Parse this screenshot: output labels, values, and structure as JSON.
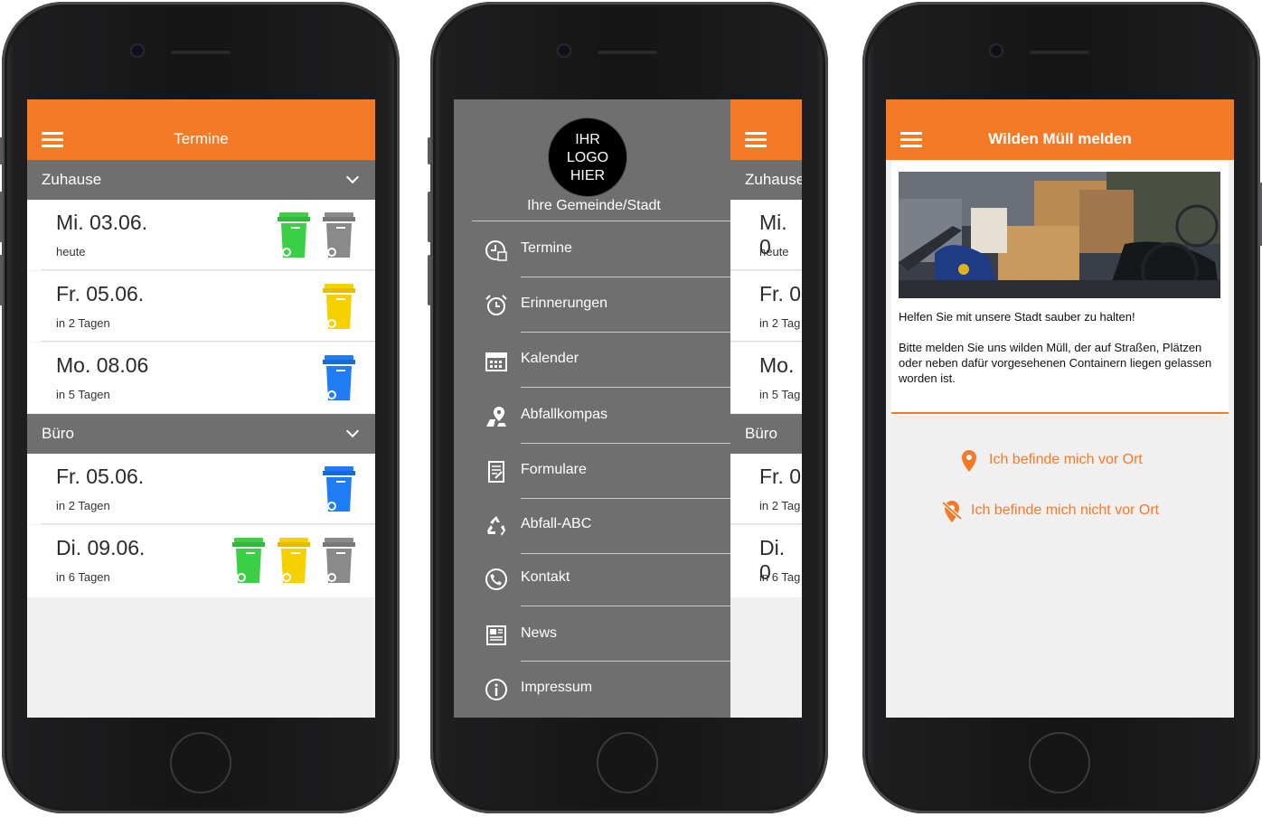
{
  "colors": {
    "accent": "#f47a27",
    "group_bg": "#6f6f6f",
    "bin_green": "#3bd046",
    "bin_gray": "#8a8a8a",
    "bin_yellow": "#f7d000",
    "bin_blue": "#1f7cf2"
  },
  "screen1": {
    "title": "Termine",
    "groups": [
      {
        "name": "Zuhause",
        "entries": [
          {
            "date": "Mi. 03.06.",
            "sub": "heute",
            "bins": [
              "green",
              "gray"
            ]
          },
          {
            "date": "Fr. 05.06.",
            "sub": "in 2 Tagen",
            "bins": [
              "yellow"
            ]
          },
          {
            "date": "Mo. 08.06",
            "sub": "in 5 Tagen",
            "bins": [
              "blue"
            ]
          }
        ]
      },
      {
        "name": "Büro",
        "entries": [
          {
            "date": "Fr. 05.06.",
            "sub": "in 2 Tagen",
            "bins": [
              "blue"
            ]
          },
          {
            "date": "Di. 09.06.",
            "sub": "in 6 Tagen",
            "bins": [
              "green",
              "yellow",
              "gray"
            ]
          }
        ]
      }
    ]
  },
  "screen2": {
    "logo_lines": [
      "IHR",
      "LOGO",
      "HIER"
    ],
    "municipality": "Ihre Gemeinde/Stadt",
    "menu": [
      {
        "label": "Termine",
        "icon": "clock-calendar-icon"
      },
      {
        "label": "Erinnerungen",
        "icon": "alarm-clock-icon"
      },
      {
        "label": "Kalender",
        "icon": "calendar-icon"
      },
      {
        "label": "Abfallkompas",
        "icon": "map-pin-icon"
      },
      {
        "label": "Formulare",
        "icon": "form-icon"
      },
      {
        "label": "Abfall-ABC",
        "icon": "recycle-icon"
      },
      {
        "label": "Kontakt",
        "icon": "phone-icon"
      },
      {
        "label": "News",
        "icon": "newspaper-icon"
      },
      {
        "label": "Impressum",
        "icon": "info-icon"
      }
    ],
    "peek": {
      "groups": [
        "Zuhause",
        "Büro"
      ],
      "dates": [
        "Mi. 0",
        "Fr. 0",
        "Mo.",
        "Fr. 0",
        "Di. 0"
      ],
      "subs": [
        "heute",
        "in 2 Tag",
        "in 5 Tag",
        "in 2 Tag",
        "in 6 Tag"
      ]
    }
  },
  "screen3": {
    "title": "Wilden Müll melden",
    "intro": "Helfen Sie mit unsere Stadt sauber zu halten!",
    "body": "Bitte melden Sie uns wilden Müll, der auf Straßen, Plätzen oder neben dafür vorgesehenen Containern liegen gelassen worden ist.",
    "action_on_site": "Ich befinde mich vor Ort",
    "action_off_site": "Ich befinde mich nicht vor Ort"
  }
}
